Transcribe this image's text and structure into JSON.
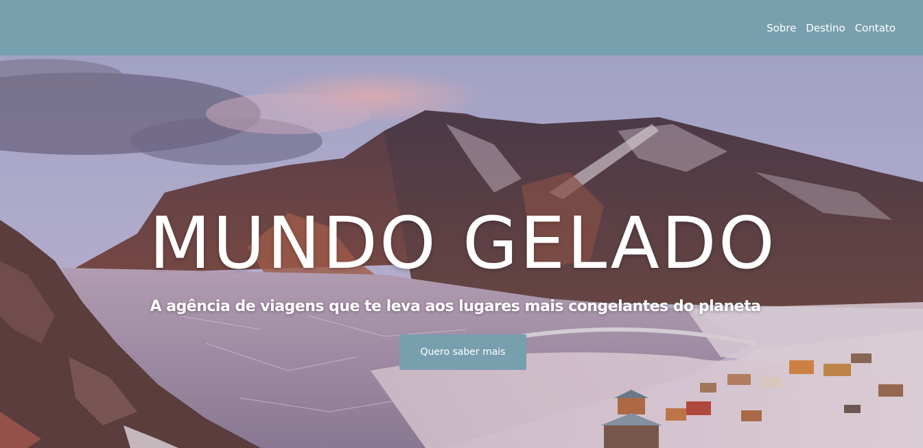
{
  "navbar": {
    "background": "#789fae",
    "links": [
      {
        "label": "Sobre"
      },
      {
        "label": "Destino"
      },
      {
        "label": "Contato"
      }
    ]
  },
  "hero": {
    "image": "frozen-lake-mountains-village-sunset",
    "title": "MUNDO GELADO",
    "subtitle": "A agência de viagens que te leva aos lugares mais congelantes do planeta",
    "cta_label": "Quero saber mais",
    "accent_color": "#789fae"
  }
}
